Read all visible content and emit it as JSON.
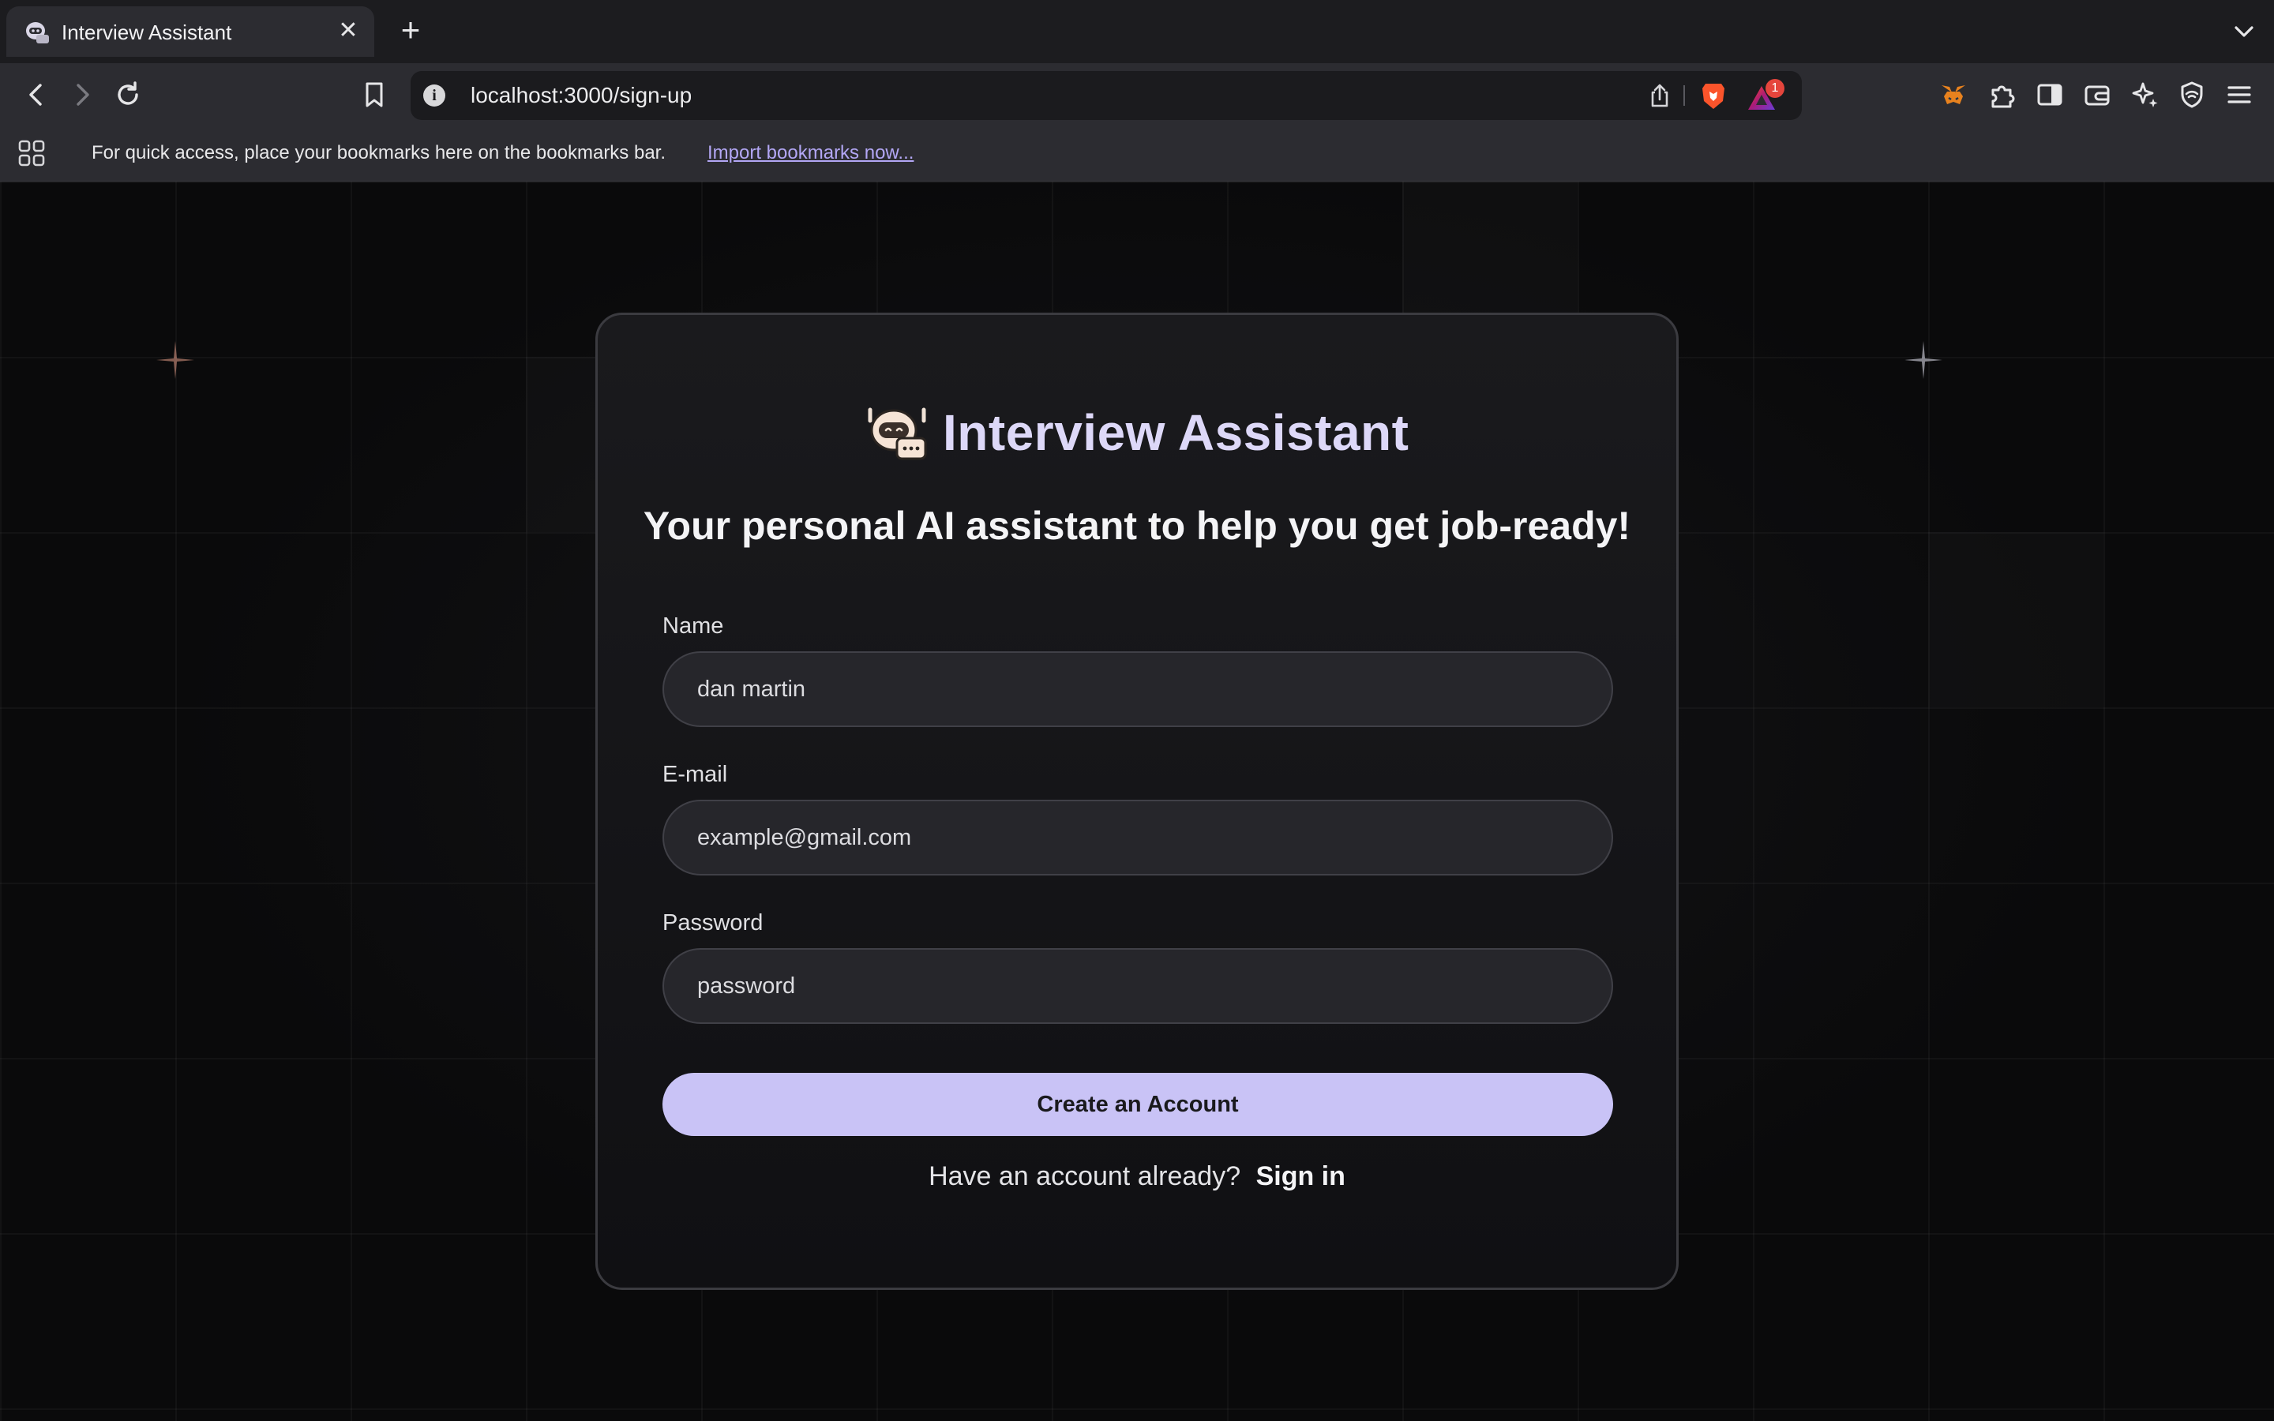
{
  "browser": {
    "tab_title": "Interview Assistant",
    "tab_close": "✕",
    "new_tab": "+",
    "url": "localhost:3000/sign-up",
    "rewards_count": "1",
    "bookmarks_message": "For quick access, place your bookmarks here on the bookmarks bar.",
    "bookmarks_import": "Import bookmarks now...",
    "icons": [
      "back-icon",
      "forward-icon",
      "reload-icon",
      "bookmark-icon",
      "info-icon",
      "share-icon",
      "brave-shields-icon",
      "brave-rewards-icon",
      "metamask-icon",
      "extensions-icon",
      "sidebar-icon",
      "wallet-icon",
      "leo-ai-icon",
      "vpn-icon",
      "menu-icon",
      "apps-icon",
      "tab-list-icon"
    ]
  },
  "card": {
    "brand_title": "Interview Assistant",
    "tagline": "Your personal AI assistant to help you get job-ready!",
    "fields": {
      "name": {
        "label": "Name",
        "value": "dan martin"
      },
      "email": {
        "label": "E-mail",
        "value": "example@gmail.com"
      },
      "password": {
        "label": "Password",
        "value": "password"
      }
    },
    "cta_label": "Create an Account",
    "signin_prompt": "Have an account already?",
    "signin_link": "Sign in"
  },
  "colors": {
    "accent": "#c9c3f6",
    "brand_text": "#ddd8f8",
    "page_bg": "#0a0a0b",
    "card_bg": "#16161a",
    "field_bg": "#26262b",
    "badge": "#e5453c"
  }
}
